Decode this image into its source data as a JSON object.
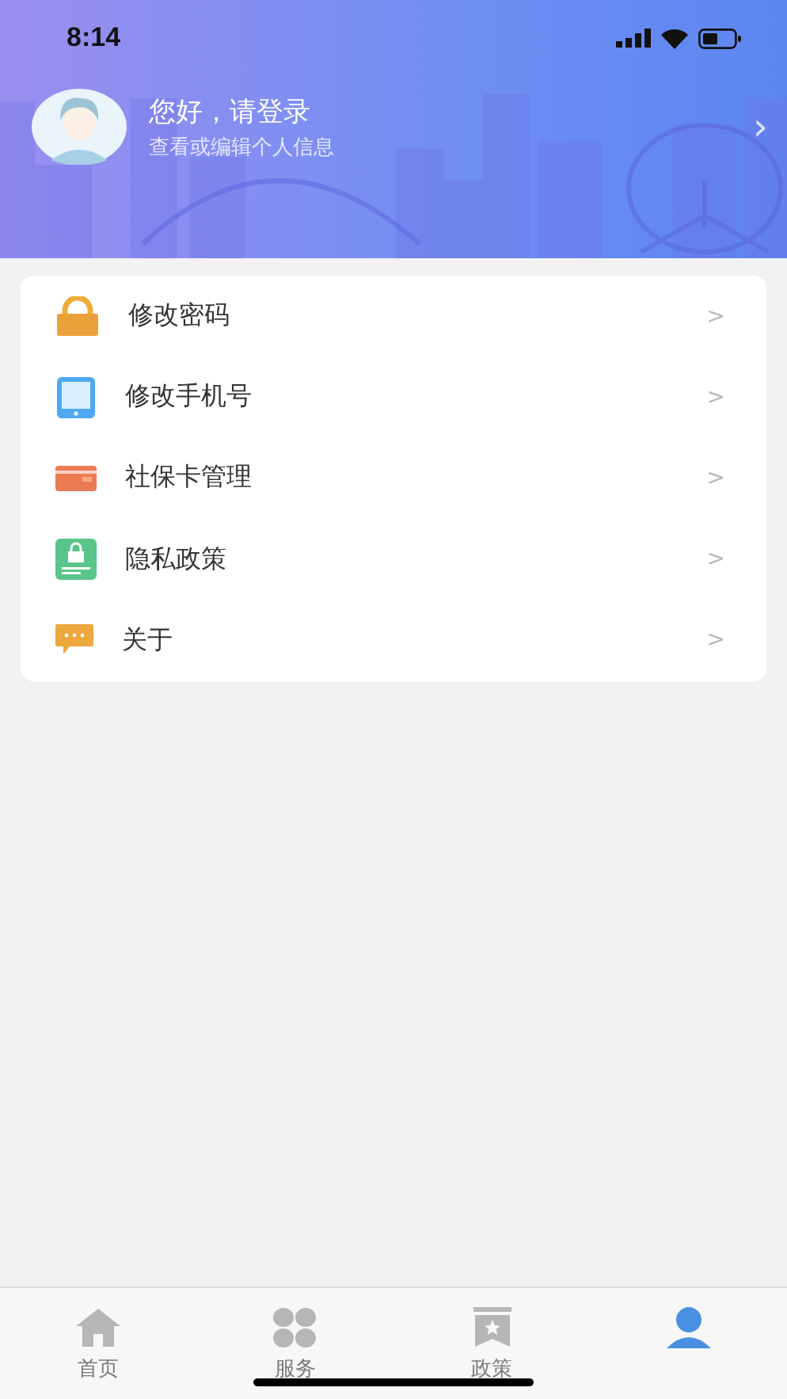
{
  "status_bar": {
    "time": "8:14"
  },
  "profile": {
    "greeting": "您好，请登录",
    "subtitle": "查看或编辑个人信息",
    "chevron": "›"
  },
  "menu": [
    {
      "kind": "lock",
      "label": "修改密码",
      "chevron": ">"
    },
    {
      "kind": "tablet",
      "label": "修改手机号",
      "chevron": ">"
    },
    {
      "kind": "card",
      "label": "社保卡管理",
      "chevron": ">"
    },
    {
      "kind": "document",
      "label": "隐私政策",
      "chevron": ">"
    },
    {
      "kind": "chat",
      "label": "关于",
      "chevron": ">"
    }
  ],
  "tab_bar": [
    {
      "kind": "home",
      "label": "首页",
      "selected": false
    },
    {
      "kind": "grid",
      "label": "服务",
      "selected": false
    },
    {
      "kind": "bookmark",
      "label": "政策",
      "selected": false
    },
    {
      "kind": "person",
      "selected": true
    }
  ]
}
